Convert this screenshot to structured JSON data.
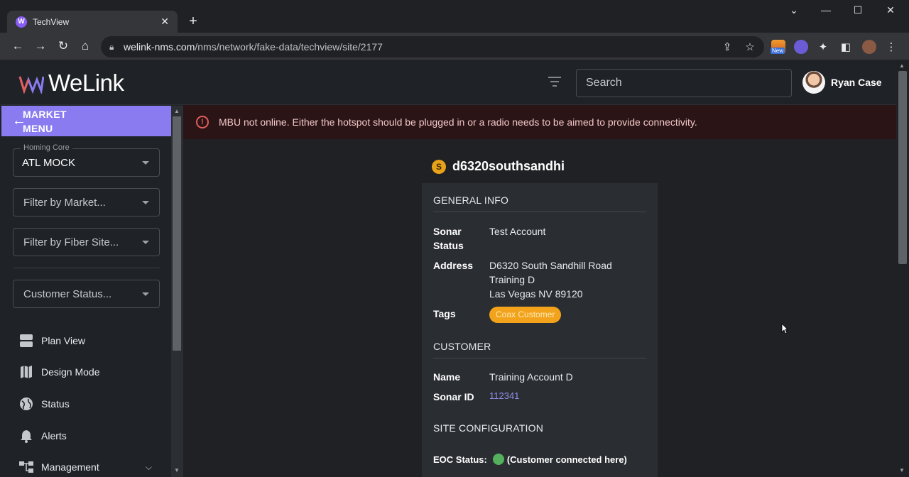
{
  "browser": {
    "tab_title": "TechView",
    "tab_favicon": "W",
    "url_host": "welink-nms.com",
    "url_path": "/nms/network/fake-data/techview/site/2177",
    "extension_badge": "New"
  },
  "header": {
    "logo_text": "WeLink",
    "search_placeholder": "Search",
    "user_name": "Ryan Case"
  },
  "sidebar": {
    "market_menu_label": "MARKET MENU",
    "homing_core_legend": "Homing Core",
    "homing_core_value": "ATL MOCK",
    "filter_market": "Filter by Market...",
    "filter_fiber": "Filter by Fiber Site...",
    "customer_status": "Customer Status...",
    "nav": [
      {
        "label": "Plan View",
        "icon": "plan-view-icon"
      },
      {
        "label": "Design Mode",
        "icon": "map-icon"
      },
      {
        "label": "Status",
        "icon": "globe-icon"
      },
      {
        "label": "Alerts",
        "icon": "bell-icon"
      },
      {
        "label": "Management",
        "icon": "hierarchy-icon"
      }
    ]
  },
  "alert": {
    "message": "MBU not online. Either the hotspot should be plugged in or a radio needs to be aimed to provide connectivity."
  },
  "site": {
    "badge": "S",
    "name": "d6320southsandhi",
    "general_info_heading": "GENERAL INFO",
    "sonar_status_label": "Sonar Status",
    "sonar_status_value": "Test Account",
    "address_label": "Address",
    "address_line1": "D6320 South Sandhill Road",
    "address_line2": "Training D",
    "address_line3": "Las Vegas NV 89120",
    "tags_label": "Tags",
    "tag": "Coax Customer",
    "customer_heading": "CUSTOMER",
    "name_label": "Name",
    "name_value": "Training Account D",
    "sonar_id_label": "Sonar ID",
    "sonar_id_value": "112341",
    "site_config_heading": "SITE CONFIGURATION",
    "eoc_label": "EOC Status:",
    "eoc_value": "(Customer connected here)",
    "eoc_color": "#54b05c"
  },
  "colors": {
    "accent": "#8a7cf0",
    "tag": "#f2a31b",
    "error": "#e35d5d"
  }
}
